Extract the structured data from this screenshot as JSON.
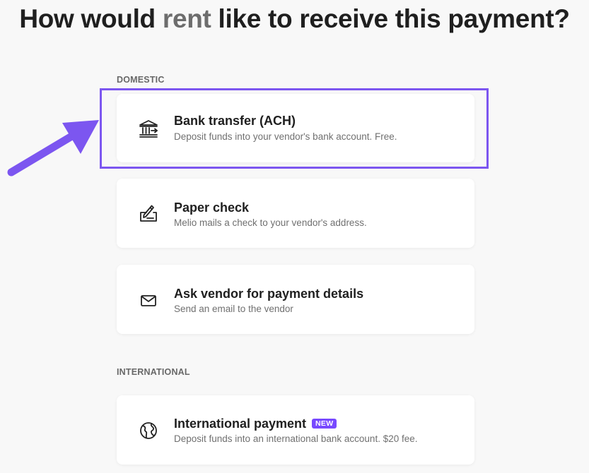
{
  "header": {
    "title_before": "How would ",
    "vendor_name": "rent",
    "title_after": " like to receive this payment?"
  },
  "sections": {
    "domestic_label": "DOMESTIC",
    "international_label": "INTERNATIONAL"
  },
  "options": {
    "bank_transfer": {
      "title": "Bank transfer (ACH)",
      "description": "Deposit funds into your vendor's bank account. Free.",
      "icon": "bank-icon"
    },
    "paper_check": {
      "title": "Paper check",
      "description": "Melio mails a check to your vendor's address.",
      "icon": "check-pen-icon"
    },
    "ask_vendor": {
      "title": "Ask vendor for payment details",
      "description": "Send an email to the vendor",
      "icon": "envelope-icon"
    },
    "international": {
      "title": "International payment",
      "badge": "NEW",
      "description": "Deposit funds into an international bank account. $20 fee.",
      "icon": "globe-icon"
    }
  },
  "annotation": {
    "highlight_target": "bank_transfer",
    "annotation_color": "#7c56f0",
    "badge_color": "#7849ff"
  }
}
